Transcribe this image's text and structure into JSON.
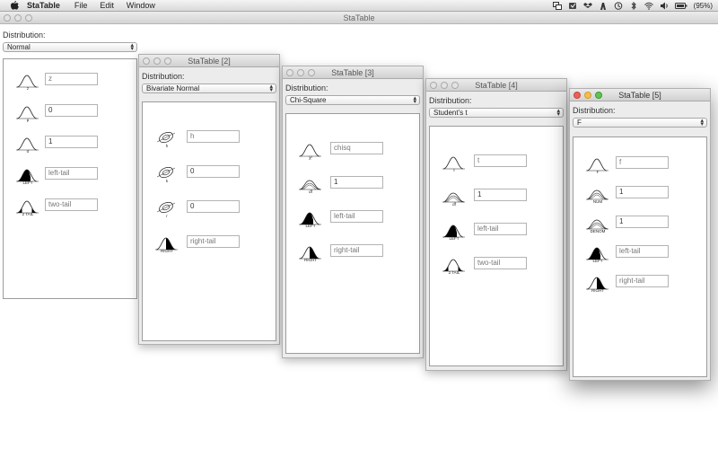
{
  "menubar": {
    "app_name": "StaTable",
    "menus": [
      "File",
      "Edit",
      "Window"
    ],
    "battery": "(95%)"
  },
  "main_window": {
    "title": "StaTable"
  },
  "windows": [
    {
      "title": "StaTable",
      "distribution_label": "Distribution:",
      "distribution": "Normal",
      "rows": [
        {
          "icon": "normal-z-icon",
          "caption": "z",
          "value": "z",
          "placeholder": true
        },
        {
          "icon": "normal-mu-icon",
          "caption": "μ",
          "value": "0",
          "placeholder": false
        },
        {
          "icon": "normal-sigma-icon",
          "caption": "σ",
          "value": "1",
          "placeholder": false
        },
        {
          "icon": "left-tail-icon",
          "caption": "LEFT",
          "value": "left-tail",
          "placeholder": true
        },
        {
          "icon": "two-tail-icon",
          "caption": "2 TAIL",
          "value": "two-tail",
          "placeholder": true
        }
      ]
    },
    {
      "title": "StaTable [2]",
      "distribution_label": "Distribution:",
      "distribution": "Bivariate Normal",
      "rows": [
        {
          "icon": "bivariate-h-icon",
          "caption": "h",
          "value": "h",
          "placeholder": true
        },
        {
          "icon": "bivariate-k-icon",
          "caption": "k",
          "value": "0",
          "placeholder": false
        },
        {
          "icon": "bivariate-r-icon",
          "caption": "r",
          "value": "0",
          "placeholder": false
        },
        {
          "icon": "right-tail-icon",
          "caption": "RIGHT",
          "value": "right-tail",
          "placeholder": true
        }
      ]
    },
    {
      "title": "StaTable [3]",
      "distribution_label": "Distribution:",
      "distribution": "Chi-Square",
      "rows": [
        {
          "icon": "chisq-icon",
          "caption": "χ²",
          "value": "chisq",
          "placeholder": true
        },
        {
          "icon": "df-icon",
          "caption": "df",
          "value": "1",
          "placeholder": false
        },
        {
          "icon": "left-tail-icon",
          "caption": "LEFT",
          "value": "left-tail",
          "placeholder": true
        },
        {
          "icon": "right-tail-icon",
          "caption": "RIGHT",
          "value": "right-tail",
          "placeholder": true
        }
      ]
    },
    {
      "title": "StaTable [4]",
      "distribution_label": "Distribution:",
      "distribution": "Student's t",
      "rows": [
        {
          "icon": "t-icon",
          "caption": "t",
          "value": "t",
          "placeholder": true
        },
        {
          "icon": "df-icon",
          "caption": "df",
          "value": "1",
          "placeholder": false
        },
        {
          "icon": "left-tail-icon",
          "caption": "LEFT",
          "value": "left-tail",
          "placeholder": true
        },
        {
          "icon": "two-tail-icon",
          "caption": "2 TAIL",
          "value": "two-tail",
          "placeholder": true
        }
      ]
    },
    {
      "title": "StaTable [5]",
      "distribution_label": "Distribution:",
      "distribution": "F",
      "rows": [
        {
          "icon": "f-icon",
          "caption": "F",
          "value": "f",
          "placeholder": true
        },
        {
          "icon": "df-num-icon",
          "caption": "NUM",
          "value": "1",
          "placeholder": false
        },
        {
          "icon": "df-denom-icon",
          "caption": "DENOM",
          "value": "1",
          "placeholder": false
        },
        {
          "icon": "left-tail-icon",
          "caption": "LEFT",
          "value": "left-tail",
          "placeholder": true
        },
        {
          "icon": "right-tail-icon",
          "caption": "RIGHT",
          "value": "right-tail",
          "placeholder": true
        }
      ]
    }
  ]
}
